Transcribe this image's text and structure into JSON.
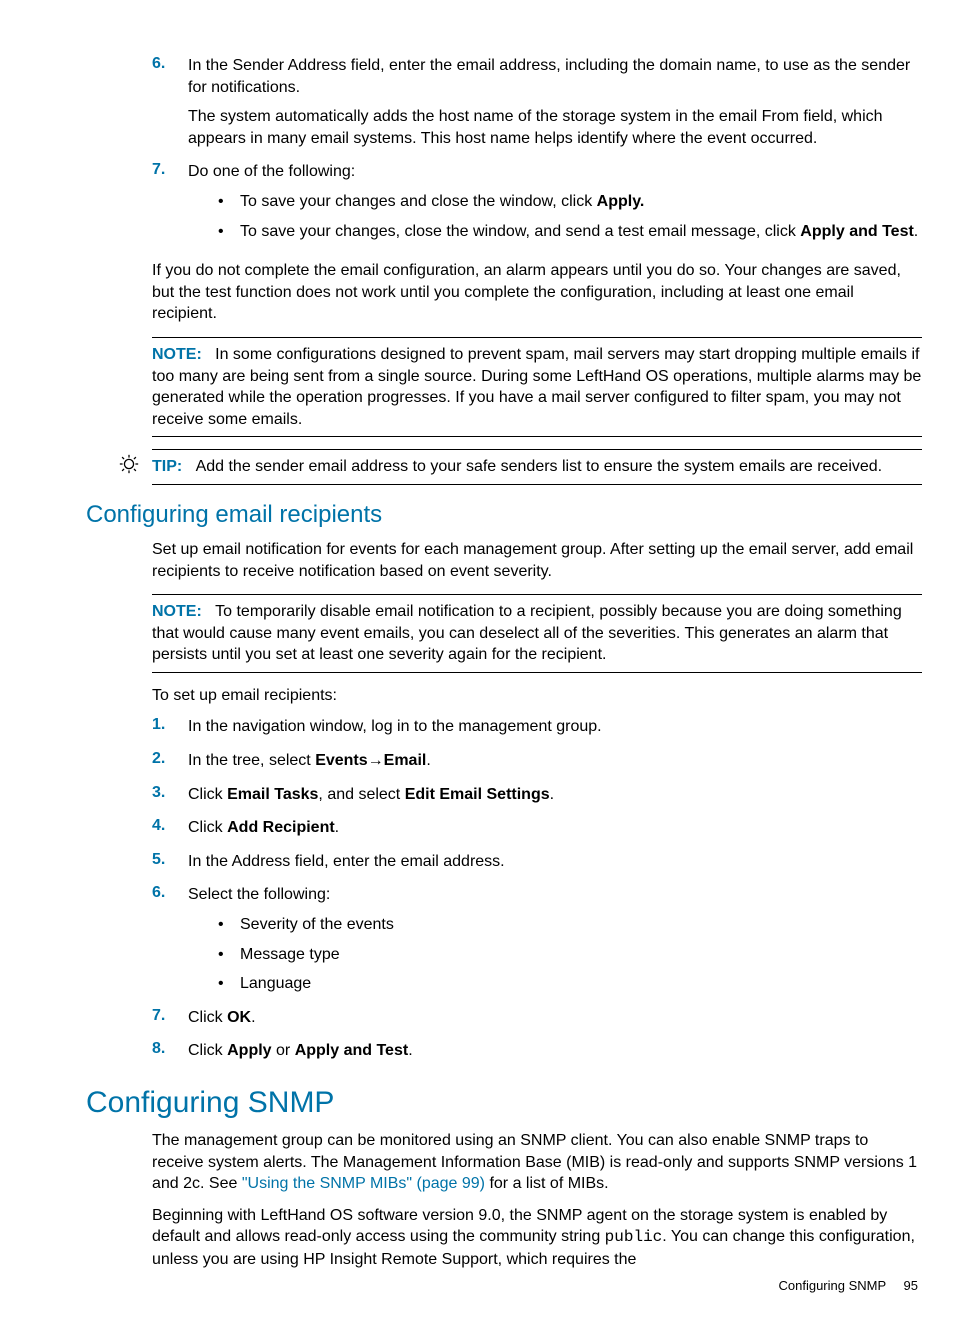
{
  "steps_top": {
    "s6": {
      "num": "6.",
      "p1": "In the Sender Address field, enter the email address, including the domain name, to use as the sender for notifications.",
      "p2": "The system automatically adds the host name of the storage system in the email From field, which appears in many email systems. This host name helps identify where the event occurred."
    },
    "s7": {
      "num": "7.",
      "p1": "Do one of the following:",
      "b1a": "To save your changes and close the window, click ",
      "b1b": "Apply.",
      "b2a": "To save your changes, close the window, and send a test email message, click ",
      "b2b": "Apply and Test",
      "b2c": "."
    }
  },
  "para_after": "If you do not complete the email configuration, an alarm appears until you do so. Your changes are saved, but the test function does not work until you complete the configuration, including at least one email recipient.",
  "note1": {
    "label": "NOTE:",
    "text": "In some configurations designed to prevent spam, mail servers may start dropping multiple emails if too many are being sent from a single source. During some LeftHand OS operations, multiple alarms may be generated while the operation progresses. If you have a mail server configured to filter spam, you may not receive some emails."
  },
  "tip1": {
    "label": "TIP:",
    "text": "Add the sender email address to your safe senders list to ensure the system emails are received."
  },
  "section2": {
    "title": "Configuring email recipients",
    "intro": "Set up email notification for events for each management group. After setting up the email server, add email recipients to receive notification based on event severity.",
    "note": {
      "label": "NOTE:",
      "text": "To temporarily disable email notification to a recipient, possibly because you are doing something that would cause many event emails, you can deselect all of the severities. This generates an alarm that persists until you set at least one severity again for the recipient."
    },
    "leadin": "To set up email recipients:",
    "steps": {
      "s1": {
        "num": "1.",
        "text": "In the navigation window, log in to the management group."
      },
      "s2": {
        "num": "2.",
        "a": "In the tree, select ",
        "b": "Events",
        "c": "→",
        "d": "Email",
        "e": "."
      },
      "s3": {
        "num": "3.",
        "a": "Click ",
        "b": "Email Tasks",
        "c": ", and select ",
        "d": "Edit Email Settings",
        "e": "."
      },
      "s4": {
        "num": "4.",
        "a": "Click ",
        "b": "Add Recipient",
        "c": "."
      },
      "s5": {
        "num": "5.",
        "text": "In the Address field, enter the email address."
      },
      "s6": {
        "num": "6.",
        "text": "Select the following:",
        "b1": "Severity of the events",
        "b2": "Message type",
        "b3": "Language"
      },
      "s7": {
        "num": "7.",
        "a": "Click ",
        "b": "OK",
        "c": "."
      },
      "s8": {
        "num": "8.",
        "a": "Click ",
        "b": "Apply",
        "c": " or ",
        "d": "Apply and Test",
        "e": "."
      }
    }
  },
  "section3": {
    "title": "Configuring SNMP",
    "p1a": "The management group can be monitored using an SNMP client. You can also enable SNMP traps to receive system alerts. The Management Information Base (MIB) is read-only and supports SNMP versions 1 and 2c. See ",
    "p1link": "\"Using the SNMP MIBs\" (page 99)",
    "p1b": " for a list of MIBs.",
    "p2a": "Beginning with LeftHand OS software version 9.0, the SNMP agent on the storage system is enabled by default and allows read-only access using the community string ",
    "p2code": "public",
    "p2b": ". You can change this configuration, unless you are using HP Insight Remote Support, which requires the"
  },
  "footer": {
    "text": "Configuring SNMP",
    "page": "95"
  }
}
